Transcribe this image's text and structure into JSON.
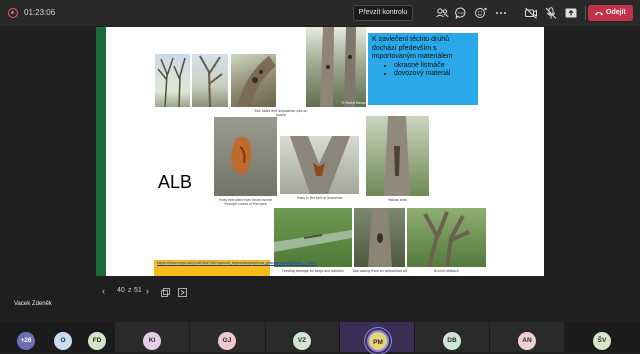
{
  "topbar": {
    "timer": "01:23:06",
    "control_button": "Převzít kontrolu",
    "leave_button": "Odejít"
  },
  "slide": {
    "blue_box": {
      "text": "K zavlečení těchto druhů dochází především s importovaným materiálem",
      "bullets": [
        "okrasné listnáče",
        "dovozový materiál"
      ]
    },
    "alb": "ALB",
    "link": "https://www.eppo.int/QUARANTINE/special_topics/anoplophora_glabripennis/ANOLGL_IT.htm",
    "captions": {
      "c1": "Exit holes and oviposition pits on maple",
      "c2": "© Forest Research",
      "c3": "Frass extruded from larval tunnel through cracks of the bark",
      "c4": "Frass in the fork of branches",
      "c5": "Hollow bark",
      "c6": "Feeding damage on twigs and petioles",
      "c7": "Sap oozing from an oviposition pit",
      "c8": "Branch dieback"
    },
    "colors": {
      "accent_bar": "#1d6b3a",
      "blue_box": "#2aa8ea",
      "link_box": "#f3bb1c"
    }
  },
  "presenter": {
    "name": "Vacek Zdeněk"
  },
  "pager": {
    "current": "40",
    "separator": "z",
    "total": "51"
  },
  "participants": [
    {
      "initials": "+26",
      "color": "#6b6fb8"
    },
    {
      "initials": "O",
      "color": "#c9dcf0"
    },
    {
      "initials": "FD",
      "color": "#cfe6c9"
    },
    {
      "initials": "KI",
      "color": "#e3cfe6"
    },
    {
      "initials": "GJ",
      "color": "#f0c9cf"
    },
    {
      "initials": "VZ",
      "color": "#cfe6d0"
    },
    {
      "initials": "PM",
      "color": "#e6d47a"
    },
    {
      "initials": "DB",
      "color": "#cfe6d6"
    },
    {
      "initials": "AN",
      "color": "#f0d0d3"
    },
    {
      "initials": "ŠV",
      "color": "#d6e6c9"
    }
  ]
}
